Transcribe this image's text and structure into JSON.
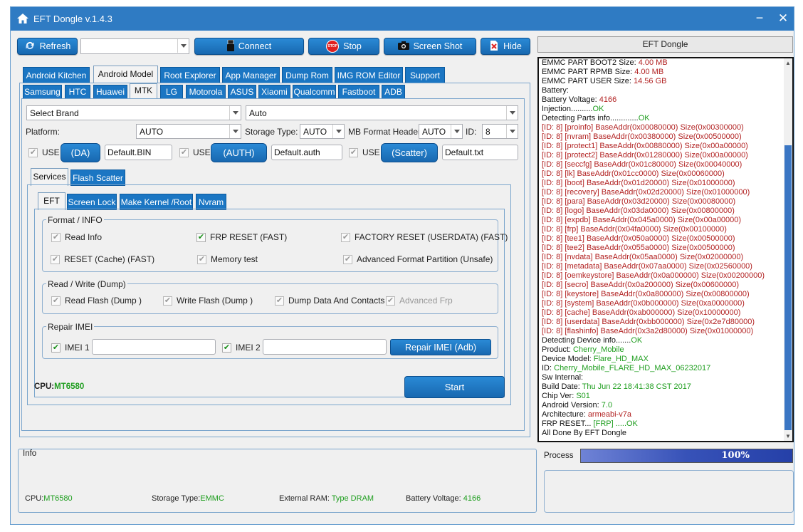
{
  "window": {
    "title": "EFT Dongle  v.1.4.3",
    "minimize": "−",
    "close": "✕"
  },
  "toolbar": {
    "refresh": "Refresh",
    "port_value": "",
    "connect": "Connect",
    "stop": "Stop",
    "stop_badge": "STOP",
    "screenshot": "Screen Shot",
    "hide": "Hide"
  },
  "side_header": "EFT Dongle",
  "main_tabs": [
    "Android Kitchen",
    "Android Model",
    "Root Explorer",
    "App Manager",
    "Dump Rom",
    "IMG ROM Editor",
    "Support"
  ],
  "brand_tabs": [
    "Samsung",
    "HTC",
    "Huawei",
    "MTK",
    "LG",
    "Motorola",
    "ASUS",
    "Xiaomi",
    "Qualcomm",
    "Fastboot",
    "ADB"
  ],
  "selectors": {
    "brand": "Select Brand",
    "model": "Auto",
    "platform_label": "Platform:",
    "platform": "AUTO",
    "storage_label": "Storage Type:",
    "storage": "AUTO",
    "mb_label": "MB Format Header",
    "mb": "AUTO",
    "id_label": "ID:",
    "id": "8"
  },
  "files": {
    "use": "USE",
    "da_btn": "(DA)",
    "da_file": "Default.BIN",
    "auth_btn": "(AUTH)",
    "auth_file": "Default.auth",
    "scatter_btn": "(Scatter)",
    "scatter_file": "Default.txt"
  },
  "service_tabs": [
    "Services",
    "Flash Scatter"
  ],
  "op_tabs": [
    "EFT",
    "Screen Lock",
    "Make Kernel  /Root",
    "Nvram"
  ],
  "format_group": {
    "title": "Format / INFO",
    "items": [
      "Read Info",
      "FRP RESET (FAST)",
      "FACTORY RESET (USERDATA) (FAST)",
      "RESET (Cache) (FAST)",
      "Memory test",
      "Advanced Format Partition (Unsafe)"
    ]
  },
  "rw_group": {
    "title": "Read / Write (Dump)",
    "items": [
      "Read Flash (Dump )",
      "Write Flash (Dump )",
      "Dump Data And Contacts",
      "Advanced Frp"
    ]
  },
  "imei_group": {
    "title": "Repair IMEI",
    "imei1": "IMEI 1",
    "imei2": "IMEI 2",
    "imei1_value": "",
    "imei2_value": "",
    "repair_btn": "Repair IMEI (Adb)"
  },
  "cpu": {
    "label": "CPU:",
    "value": "MT6580"
  },
  "start_btn": "Start",
  "info": {
    "title": "Info",
    "cpu_label": "CPU:",
    "cpu": "MT6580",
    "storage_label": "Storage Type:",
    "storage": "EMMC",
    "ram_label": "External RAM:",
    "ram": "Type DRAM",
    "battery_label": "Battery Voltage:",
    "battery": "4166"
  },
  "process": {
    "label": "Process",
    "percent": "100%",
    "value": 1.0
  },
  "log": [
    {
      "t": "EMMC PART BOOT2 Size: ",
      "v": "4.00 MB",
      "c": "red"
    },
    {
      "t": "EMMC PART RPMB Size: ",
      "v": "4.00 MB",
      "c": "red"
    },
    {
      "t": "EMMC PART USER Size: ",
      "v": "14.56 GB",
      "c": "red"
    },
    {
      "t": "Battery:",
      "v": "",
      "c": ""
    },
    {
      "t": "Battery Voltage: ",
      "v": "4166",
      "c": "red"
    },
    {
      "t": "Injection..........",
      "v": "OK",
      "c": "grn"
    },
    {
      "t": "Detecting Parts info.............",
      "v": "OK",
      "c": "grn"
    },
    {
      "t": "[ID: 8] [proinfo] BaseAddr(0x00080000) Size(0x00300000)",
      "v": "",
      "c": "all"
    },
    {
      "t": "[ID: 8] [nvram] BaseAddr(0x00380000) Size(0x00500000)",
      "v": "",
      "c": "all"
    },
    {
      "t": "[ID: 8] [protect1] BaseAddr(0x00880000) Size(0x00a00000)",
      "v": "",
      "c": "all"
    },
    {
      "t": "[ID: 8] [protect2] BaseAddr(0x01280000) Size(0x00a00000)",
      "v": "",
      "c": "all"
    },
    {
      "t": "[ID: 8] [seccfg] BaseAddr(0x01c80000) Size(0x00040000)",
      "v": "",
      "c": "all"
    },
    {
      "t": "[ID: 8] [lk] BaseAddr(0x01cc0000) Size(0x00060000)",
      "v": "",
      "c": "all"
    },
    {
      "t": "[ID: 8] [boot] BaseAddr(0x01d20000) Size(0x01000000)",
      "v": "",
      "c": "all"
    },
    {
      "t": "[ID: 8] [recovery] BaseAddr(0x02d20000) Size(0x01000000)",
      "v": "",
      "c": "all"
    },
    {
      "t": "[ID: 8] [para] BaseAddr(0x03d20000) Size(0x00080000)",
      "v": "",
      "c": "all"
    },
    {
      "t": "[ID: 8] [logo] BaseAddr(0x03da0000) Size(0x00800000)",
      "v": "",
      "c": "all"
    },
    {
      "t": "[ID: 8] [expdb] BaseAddr(0x045a0000) Size(0x00a00000)",
      "v": "",
      "c": "all"
    },
    {
      "t": "[ID: 8] [frp] BaseAddr(0x04fa0000) Size(0x00100000)",
      "v": "",
      "c": "all"
    },
    {
      "t": "[ID: 8] [tee1] BaseAddr(0x050a0000) Size(0x00500000)",
      "v": "",
      "c": "all"
    },
    {
      "t": "[ID: 8] [tee2] BaseAddr(0x055a0000) Size(0x00500000)",
      "v": "",
      "c": "all"
    },
    {
      "t": "[ID: 8] [nvdata] BaseAddr(0x05aa0000) Size(0x02000000)",
      "v": "",
      "c": "all"
    },
    {
      "t": "[ID: 8] [metadata] BaseAddr(0x07aa0000) Size(0x02560000)",
      "v": "",
      "c": "all"
    },
    {
      "t": "[ID: 8] [oemkeystore] BaseAddr(0x0a000000) Size(0x00200000)",
      "v": "",
      "c": "all"
    },
    {
      "t": "[ID: 8] [secro] BaseAddr(0x0a200000) Size(0x00600000)",
      "v": "",
      "c": "all"
    },
    {
      "t": "[ID: 8] [keystore] BaseAddr(0x0a800000) Size(0x00800000)",
      "v": "",
      "c": "all"
    },
    {
      "t": "[ID: 8] [system] BaseAddr(0x0b000000) Size(0xa0000000)",
      "v": "",
      "c": "all"
    },
    {
      "t": "[ID: 8] [cache] BaseAddr(0xab000000) Size(0x10000000)",
      "v": "",
      "c": "all"
    },
    {
      "t": "[ID: 8] [userdata] BaseAddr(0xbb000000) Size(0x2e7d80000)",
      "v": "",
      "c": "all"
    },
    {
      "t": "[ID: 8] [flashinfo] BaseAddr(0x3a2d80000) Size(0x01000000)",
      "v": "",
      "c": "all"
    },
    {
      "t": "Detecting Device info.......",
      "v": "OK",
      "c": "grn"
    },
    {
      "t": "Product: ",
      "v": "Cherry_Mobile",
      "c": "grn"
    },
    {
      "t": "Device Model: ",
      "v": "Flare_HD_MAX",
      "c": "grn"
    },
    {
      "t": "ID: ",
      "v": "Cherry_Mobile_FLARE_HD_MAX_06232017",
      "c": "grn"
    },
    {
      "t": "Sw Internal:",
      "v": "",
      "c": ""
    },
    {
      "t": "Build Date: ",
      "v": "Thu Jun 22 18:41:38 CST 2017",
      "c": "grn"
    },
    {
      "t": "Chip Ver: ",
      "v": "S01",
      "c": "grn"
    },
    {
      "t": "Android Version: ",
      "v": "7.0",
      "c": "grn"
    },
    {
      "t": "Architecture: ",
      "v": "armeabi-v7a",
      "c": "red"
    },
    {
      "t": "FRP RESET... ",
      "v": "[FRP] .....OK",
      "c": "grn"
    },
    {
      "t": "All Done By EFT Dongle",
      "v": "",
      "c": ""
    }
  ]
}
